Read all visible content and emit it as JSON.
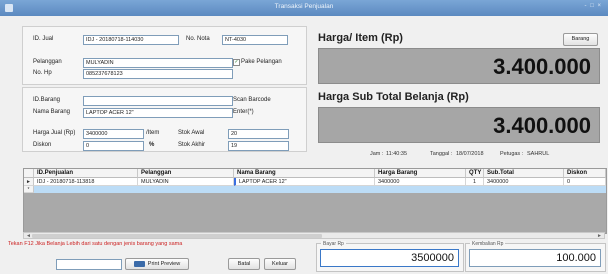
{
  "window": {
    "title": "Transaksi Penjualan",
    "controls": "- □ ×"
  },
  "form": {
    "id_jual_label": "ID. Jual",
    "id_jual_value": "IDJ - 20180718-114030",
    "no_nota_label": "No. Nota",
    "no_nota_value": "NT-4030",
    "pelanggan_label": "Pelanggan",
    "pelanggan_value": "MULYADIN",
    "pakai_pelanggan_label": "Pake Pelangan",
    "nohp_label": "No. Hp",
    "nohp_value": "085237678123",
    "idbarang_label": "ID.Barang",
    "idbarang_value": "",
    "scan_label": "Scan Barcode",
    "nama_barang_label": "Nama Barang",
    "nama_barang_value": "LAPTOP ACER 12\"",
    "enter_label": "Enter(*)",
    "harga_jual_label": "Harga Jual (Rp)",
    "harga_jual_value": "3400000",
    "per_item_label": "/Item",
    "stok_awal_label": "Stok Awal",
    "stok_awal_value": "20",
    "diskon_label": "Diskon",
    "diskon_value": "0",
    "percent_label": "%",
    "stok_akhir_label": "Stok Akhir",
    "stok_akhir_value": "19"
  },
  "right": {
    "harga_item_title": "Harga/ Item (Rp)",
    "barang_button": "Barang",
    "harga_item_display": "3.400.000",
    "subtotal_title": "Harga Sub Total Belanja (Rp)",
    "subtotal_display": "3.400.000",
    "jam_label": "Jam :",
    "jam_value": "11:40:35",
    "tanggal_label": "Tanggal :",
    "tanggal_value": "18/07/2018",
    "petugas_label": "Petugas :",
    "petugas_value": "SAHRUL"
  },
  "grid": {
    "headers": [
      "ID.Penjualan",
      "Pelanggan",
      "Nama Barang",
      "Harga Barang",
      "QTY",
      "Sub.Total",
      "Diskon"
    ],
    "rows": [
      [
        "IDJ - 20180718-113818",
        "MULYADIN",
        "LAPTOP ACER 12\"",
        "3400000",
        "1",
        "3400000",
        "0"
      ]
    ],
    "row_marker": "►",
    "new_row_marker": "*"
  },
  "footer": {
    "warning": "Tekan F12 Jika Belanja Lebih dari satu dengan jenis barang yang sama",
    "search_value": "",
    "print_preview_button": "Print Preview",
    "batal_button": "Batal",
    "keluar_button": "Keluar",
    "bayar_label": "Bayar Rp",
    "bayar_value": "3500000",
    "kembalian_label": "Kembalian Rp",
    "kembalian_value": "100.000"
  }
}
